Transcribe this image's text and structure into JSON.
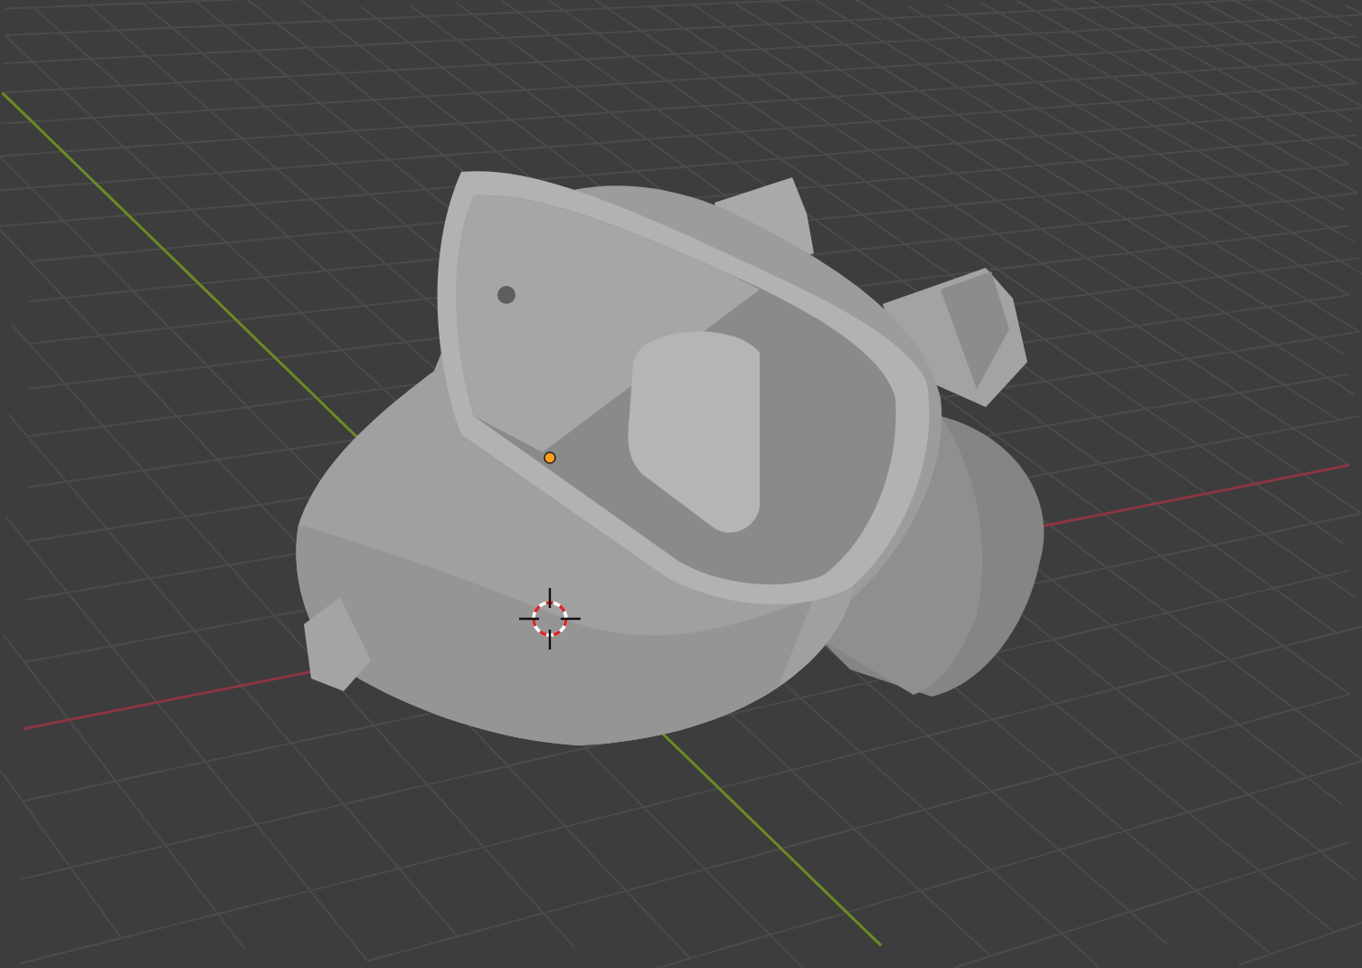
{
  "viewport": {
    "grid": true,
    "x_axis": true,
    "y_axis": true,
    "model": true,
    "origin_dot": true,
    "cursor_3d": true
  }
}
